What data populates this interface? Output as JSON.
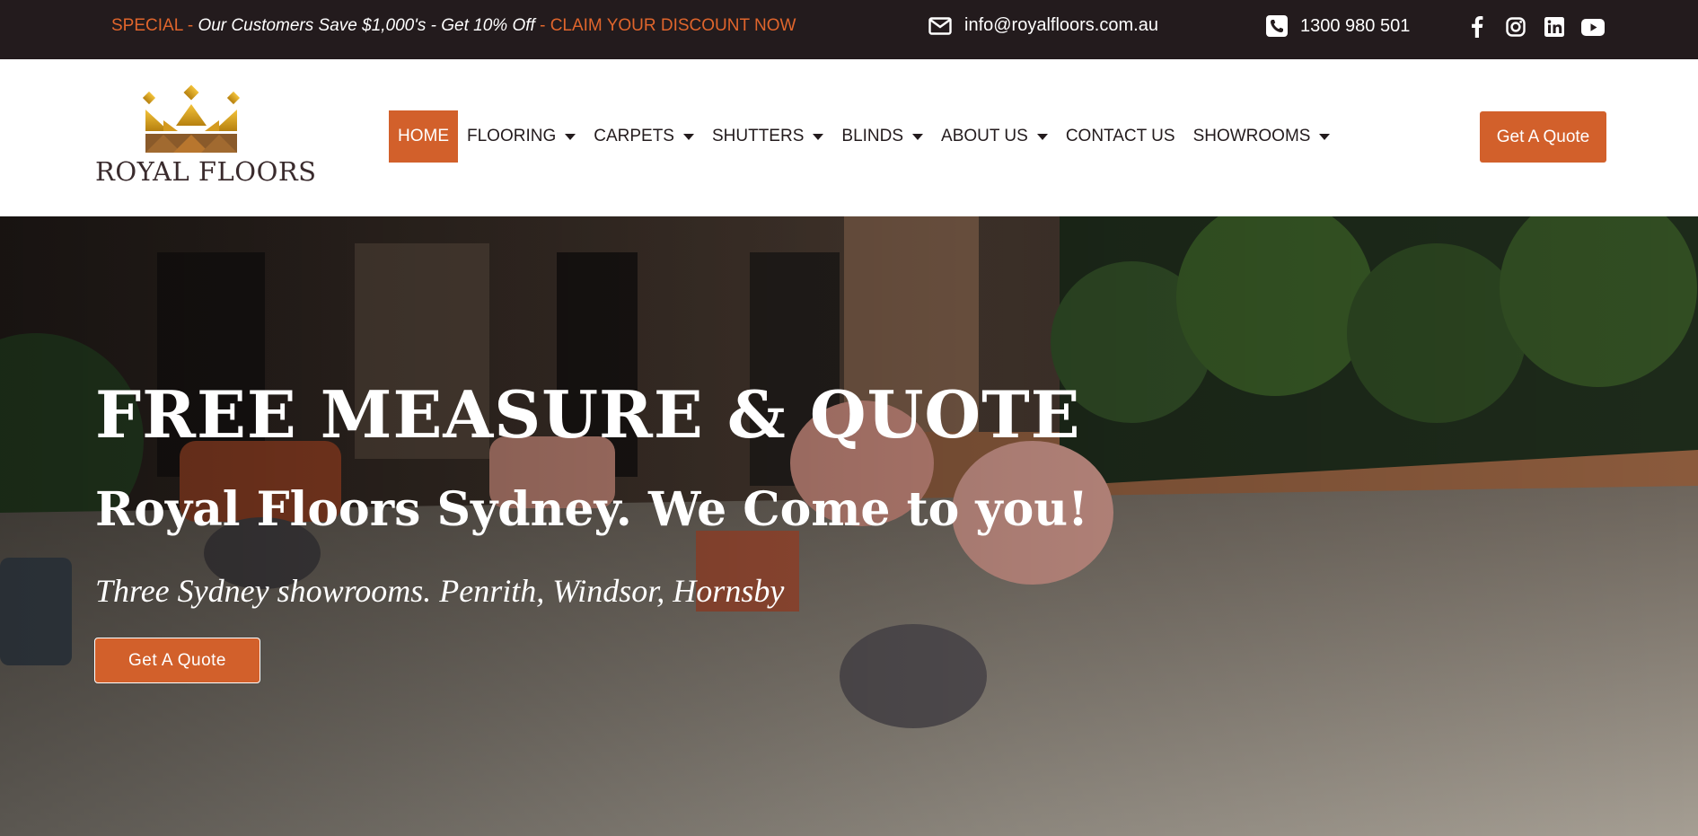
{
  "topbar": {
    "promo_label": "SPECIAL",
    "promo_sep1": " - ",
    "promo_message": "Our Customers Save $1,000's - Get 10% Off",
    "promo_sep2": " - ",
    "promo_link": "CLAIM YOUR DISCOUNT NOW",
    "email": "info@royalfloors.com.au",
    "phone": "1300 980 501",
    "socials": [
      "facebook-icon",
      "instagram-icon",
      "linkedin-icon",
      "youtube-icon"
    ]
  },
  "header": {
    "logo_text": "ROYAL FLOORS",
    "nav": [
      {
        "label": "HOME",
        "active": true,
        "dropdown": false
      },
      {
        "label": "FLOORING",
        "active": false,
        "dropdown": true
      },
      {
        "label": "CARPETS",
        "active": false,
        "dropdown": true
      },
      {
        "label": "SHUTTERS",
        "active": false,
        "dropdown": true
      },
      {
        "label": "BLINDS",
        "active": false,
        "dropdown": true
      },
      {
        "label": "ABOUT US",
        "active": false,
        "dropdown": true
      },
      {
        "label": "CONTACT US",
        "active": false,
        "dropdown": false
      },
      {
        "label": "SHOWROOMS",
        "active": false,
        "dropdown": true
      }
    ],
    "quote_button": "Get A Quote"
  },
  "hero": {
    "title": "FREE MEASURE & QUOTE",
    "subtitle": "Royal Floors Sydney. We Come to you!",
    "tagline": "Three Sydney showrooms. Penrith, Windsor, Hornsby",
    "button": "Get A Quote"
  },
  "colors": {
    "accent": "#d2602b",
    "topbar_bg": "#231b1d",
    "text_dark": "#231b1d"
  }
}
